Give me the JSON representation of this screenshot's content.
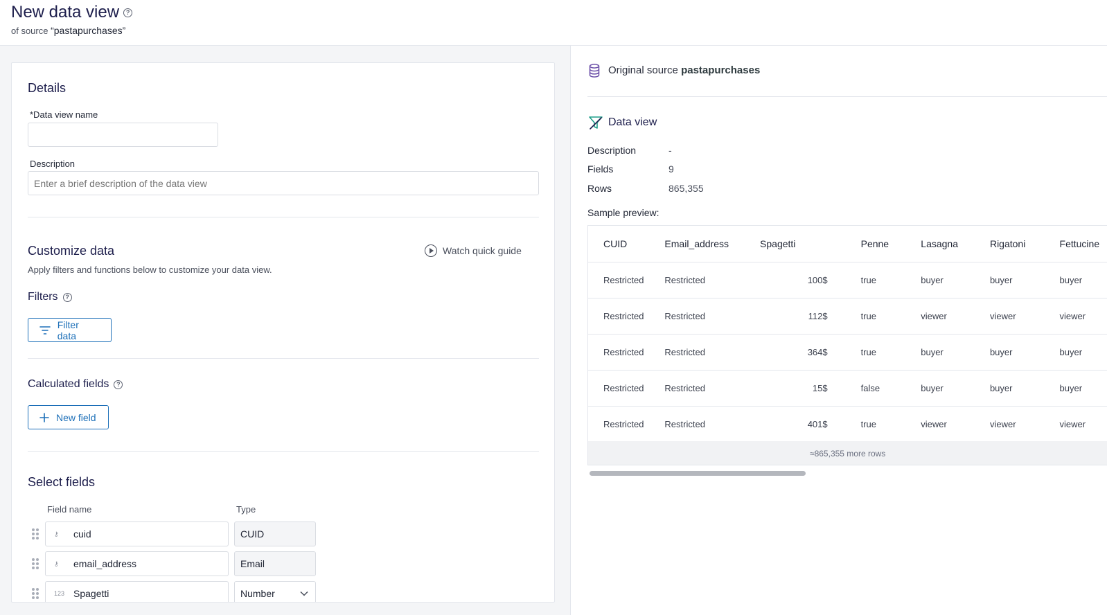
{
  "header": {
    "title": "New data view",
    "subtitle_prefix": "of source",
    "source_name": "“pastapurchases”"
  },
  "details": {
    "heading": "Details",
    "name_label": "*Data view name",
    "name_value": "",
    "description_label": "Description",
    "description_placeholder": "Enter a brief description of the data view"
  },
  "customize": {
    "heading": "Customize data",
    "guide_label": "Watch quick guide",
    "hint": "Apply filters and functions below to customize your data view.",
    "filters_heading": "Filters",
    "filter_button": "Filter data",
    "calc_heading": "Calculated fields",
    "new_field_button": "New field"
  },
  "select_fields": {
    "heading": "Select fields",
    "col_name": "Field name",
    "col_type": "Type",
    "rows": [
      {
        "icon": "key-icon",
        "glyph": "⚷",
        "name": "cuid",
        "type": "CUID"
      },
      {
        "icon": "key-icon",
        "glyph": "⚷",
        "name": "email_address",
        "type": "Email"
      },
      {
        "icon": "number-icon",
        "glyph": "123",
        "name": "Spagetti",
        "type": "Number"
      }
    ]
  },
  "source": {
    "label": "Original source",
    "name": "pastapurchases",
    "icon": "database-icon",
    "icon_color": "#6b4fa8"
  },
  "data_view": {
    "heading": "Data view",
    "icon": "data-view-icon",
    "icon_color": "#1f9e8a",
    "description_key": "Description",
    "description_value": "-",
    "fields_key": "Fields",
    "fields_value": "9",
    "rows_key": "Rows",
    "rows_value": "865,355",
    "sample_label": "Sample preview:"
  },
  "preview": {
    "columns": [
      "CUID",
      "Email_address",
      "Spagetti",
      "Penne",
      "Lasagna",
      "Rigatoni",
      "Fettucine"
    ],
    "rows": [
      [
        "Restricted",
        "Restricted",
        "100$",
        "true",
        "buyer",
        "buyer",
        "buyer"
      ],
      [
        "Restricted",
        "Restricted",
        "112$",
        "true",
        "viewer",
        "viewer",
        "viewer"
      ],
      [
        "Restricted",
        "Restricted",
        "364$",
        "true",
        "buyer",
        "buyer",
        "buyer"
      ],
      [
        "Restricted",
        "Restricted",
        "15$",
        "false",
        "buyer",
        "buyer",
        "buyer"
      ],
      [
        "Restricted",
        "Restricted",
        "401$",
        "true",
        "viewer",
        "viewer",
        "viewer"
      ]
    ],
    "more_rows": "≈865,355 more rows"
  },
  "colors": {
    "accent": "#1c6fb8",
    "title": "#1c1d4b"
  }
}
